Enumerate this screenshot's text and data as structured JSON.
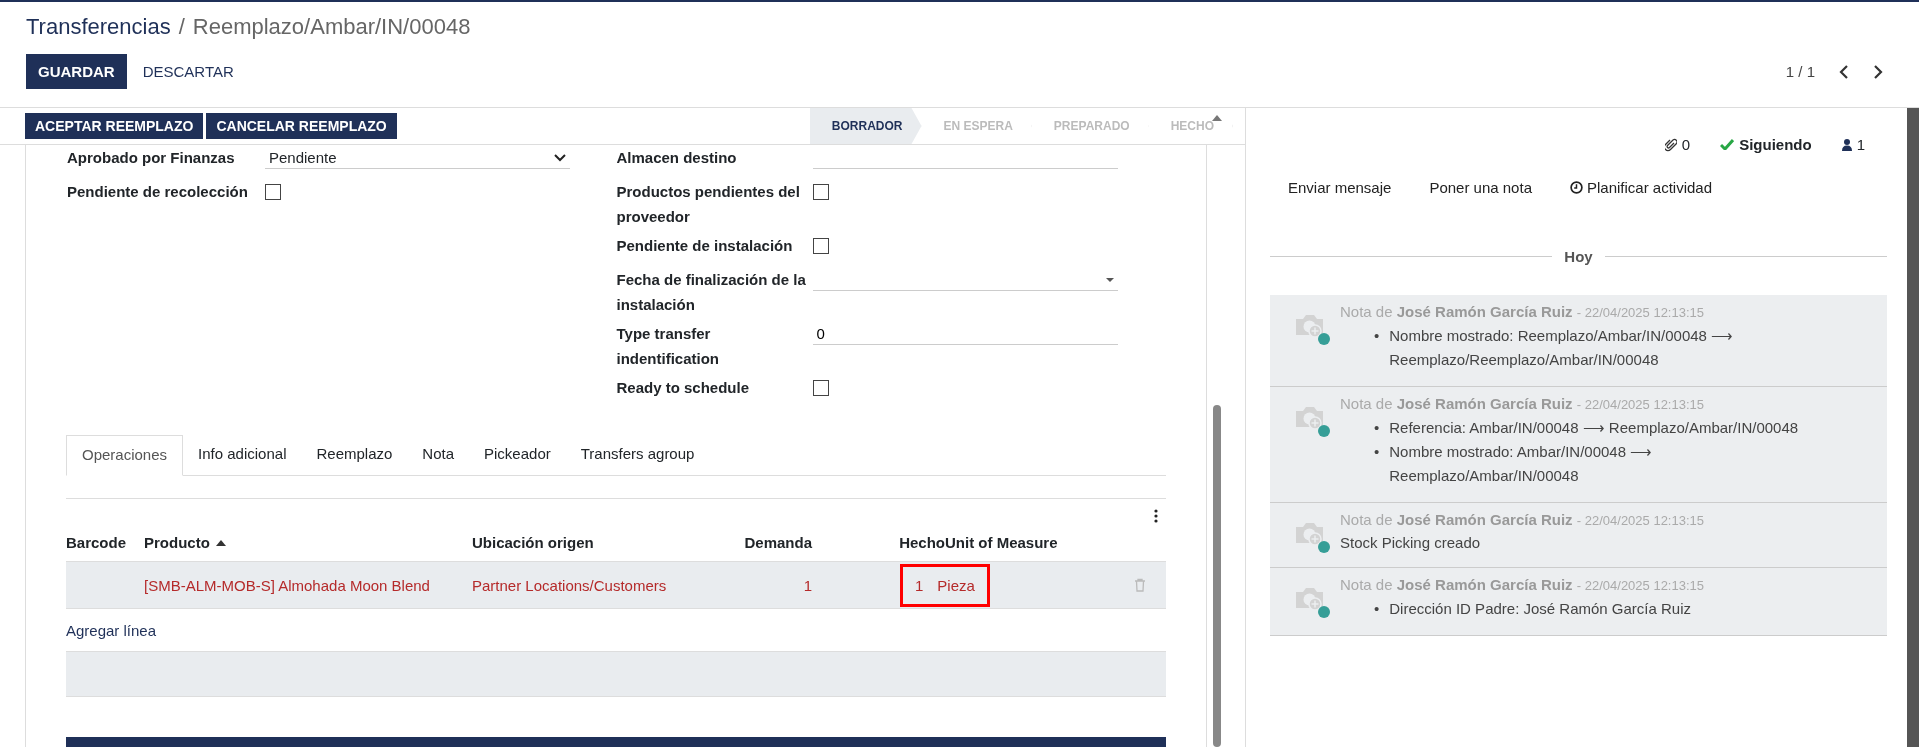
{
  "breadcrumb": {
    "parent": "Transferencias",
    "separator": "/",
    "current": "Reemplazo/Ambar/IN/00048"
  },
  "actions": [
    {
      "label": "GUARDAR",
      "kind": "primary"
    },
    {
      "label": "DESCARTAR",
      "kind": "link"
    }
  ],
  "pager": {
    "text": "1 / 1"
  },
  "header_buttons": [
    "ACEPTAR REEMPLAZO",
    "CANCELAR REEMPLAZO"
  ],
  "status_bar": [
    {
      "label": "BORRADOR",
      "selected": true
    },
    {
      "label": "EN ESPERA",
      "selected": false
    },
    {
      "label": "PREPARADO",
      "selected": false
    },
    {
      "label": "HECHO",
      "selected": false
    }
  ],
  "form": {
    "left": [
      {
        "kind": "select",
        "label": "Aprobado por Finanzas",
        "value": "Pendiente"
      },
      {
        "kind": "checkbox",
        "label": "Pendiente de recolección",
        "checked": false
      }
    ],
    "right": [
      {
        "kind": "text",
        "label": "Almacen destino"
      },
      {
        "kind": "checkbox",
        "label": "Productos pendientes del proveedor",
        "checked": false
      },
      {
        "kind": "checkbox",
        "label": "Pendiente de instalación",
        "checked": false
      },
      {
        "kind": "date",
        "label": "Fecha de finalización de la instalación"
      },
      {
        "kind": "text",
        "label": "Type transfer indentification",
        "value": "0"
      },
      {
        "kind": "checkbox",
        "label": "Ready to schedule",
        "checked": false
      }
    ]
  },
  "tabs": [
    {
      "label": "Operaciones",
      "selected": true
    },
    {
      "label": "Info adicional",
      "selected": false
    },
    {
      "label": "Reemplazo",
      "selected": false
    },
    {
      "label": "Nota",
      "selected": false
    },
    {
      "label": "Pickeador",
      "selected": false
    },
    {
      "label": "Transfers agroup",
      "selected": false
    }
  ],
  "table": {
    "columns": [
      {
        "label": "Barcode",
        "sorted": false
      },
      {
        "label": "Producto",
        "sorted": true
      },
      {
        "label": "Ubicación origen",
        "sorted": false
      },
      {
        "label": "Demanda",
        "sorted": false
      },
      {
        "label": "Hecho",
        "sorted": false
      },
      {
        "label": "Unit of Measure",
        "sorted": false
      }
    ],
    "rows": [
      {
        "product": "[SMB-ALM-MOB-S] Almohada Moon Blend",
        "location": "Partner Locations/Customers",
        "demand": "1",
        "done": "1",
        "uom": "Pieza",
        "highlighted": true
      }
    ],
    "add_line": "Agregar línea"
  },
  "chatter": {
    "attachments": "0",
    "follow": "Siguiendo",
    "followers": "1",
    "actions": [
      {
        "label": "Enviar mensaje",
        "kind": "plain"
      },
      {
        "label": "Poner una nota",
        "kind": "plain"
      },
      {
        "label": "Planificar actividad",
        "kind": "activity"
      }
    ],
    "date_separator": "Hoy",
    "messages": [
      {
        "header": "Nota de **José Ramón García Ruiz**",
        "date": "- 22/04/2025 12:13:15",
        "kind": "bullets",
        "items": [
          {
            "bullet": "•",
            "text": "Nombre mostrado: Reemplazo/Ambar/IN/00048 ⟶ Reemplazo/Reemplazo/Ambar/IN/00048"
          }
        ]
      },
      {
        "header": "Nota de **José Ramón García Ruiz**",
        "date": "- 22/04/2025 12:13:15",
        "kind": "bullets",
        "items": [
          {
            "bullet": "•",
            "text": "Referencia: Ambar/IN/00048 ⟶ Reemplazo/Ambar/IN/00048"
          },
          {
            "bullet": "•",
            "text": "Nombre mostrado: Ambar/IN/00048 ⟶ Reemplazo/Ambar/IN/00048"
          }
        ]
      },
      {
        "header": "Nota de **José Ramón García Ruiz**",
        "date": "- 22/04/2025 12:13:15",
        "kind": "text",
        "body": "Stock Picking creado"
      },
      {
        "header": "Nota de **José Ramón García Ruiz**",
        "date": "- 22/04/2025 12:13:15",
        "kind": "bullets",
        "items": [
          {
            "bullet": "•",
            "text": "Dirección ID Padre: José Ramón García Ruiz"
          }
        ]
      }
    ]
  }
}
